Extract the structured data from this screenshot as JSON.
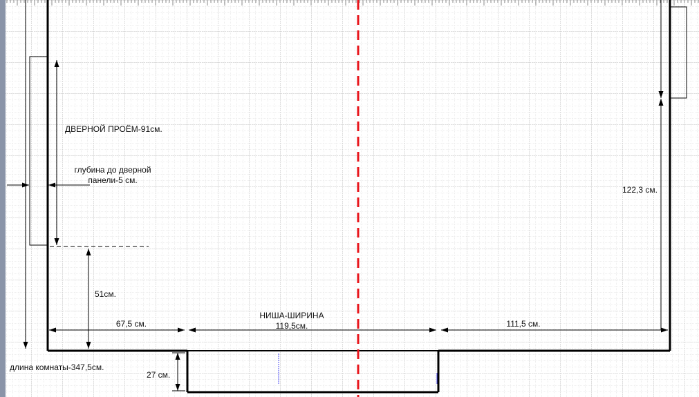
{
  "colors": {
    "grid_minor": "#dcdcdc",
    "grid_major": "#bdbdbd",
    "lines": "#000000",
    "center_line": "#e8151b",
    "left_ruler": "#8a94a8",
    "accent_blue": "#4a4af0"
  },
  "labels": {
    "door_opening": "ДВЕРНОЙ ПРОЁМ-91см.",
    "door_depth_line1": "глубина до дверной",
    "door_depth_line2": "панели-5 см.",
    "right_height": "122,3 см.",
    "left_height": "51см.",
    "seg_left": "67,5 см.",
    "niche_title": "НИША-ШИРИНА",
    "niche_width": "119,5см.",
    "seg_right": "111,5 см.",
    "room_length": "длина комнаты-347,5см.",
    "niche_depth": "27 см."
  }
}
